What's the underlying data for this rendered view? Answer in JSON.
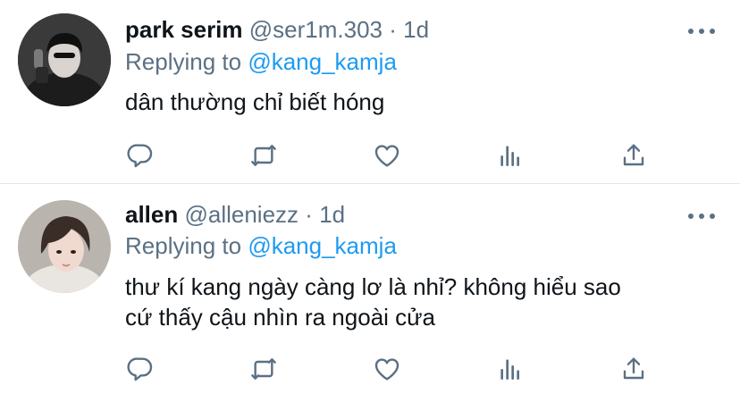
{
  "tweets": [
    {
      "name": "park serim",
      "handle": "@ser1m.303",
      "separator": "·",
      "time": "1d",
      "replying_prefix": "Replying to",
      "replying_to": "@kang_kamja",
      "text_lines": [
        "dân thường chỉ biết hóng"
      ]
    },
    {
      "name": "allen",
      "handle": "@alleniezz",
      "separator": "·",
      "time": "1d",
      "replying_prefix": "Replying to",
      "replying_to": "@kang_kamja",
      "text_lines": [
        "thư kí kang ngày càng lơ là nhỉ? không hiểu sao",
        "cứ thấy cậu nhìn ra ngoài cửa"
      ]
    }
  ],
  "icons": [
    "more-icon",
    "reply-icon",
    "retweet-icon",
    "like-icon",
    "analytics-icon",
    "share-icon"
  ],
  "colors": {
    "text": "#0f1419",
    "secondary": "#5b7083",
    "link": "#1d9bf0",
    "divider": "#e1e6ea"
  }
}
